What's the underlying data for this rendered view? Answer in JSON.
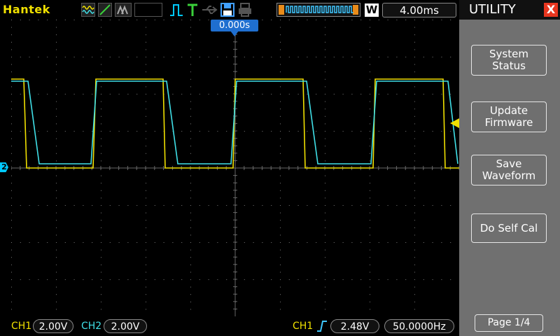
{
  "header": {
    "brand": "Hantek",
    "time_base": "4.00ms",
    "mode_letter": "W",
    "trigger_position": "0.000s"
  },
  "menu": {
    "title": "UTILITY",
    "close_label": "X",
    "buttons": [
      {
        "line1": "System",
        "line2": "Status"
      },
      {
        "line1": "Update",
        "line2": "Firmware"
      },
      {
        "line1": "Save",
        "line2": "Waveform"
      },
      {
        "line1": "Do Self Cal",
        "line2": ""
      }
    ],
    "page": "Page 1/4"
  },
  "footer": {
    "ch1_label": "CH1",
    "ch1_scale": "2.00V",
    "ch2_label": "CH2",
    "ch2_scale": "2.00V",
    "trig_source": "CH1",
    "trig_level": "2.48V",
    "frequency": "50.0000Hz"
  },
  "markers": {
    "ch2_ref": "2"
  },
  "colors": {
    "ch1": "#f0e000",
    "ch2": "#40e0e8",
    "accent": "#1f6fd0",
    "menu_bg": "#707070"
  }
}
